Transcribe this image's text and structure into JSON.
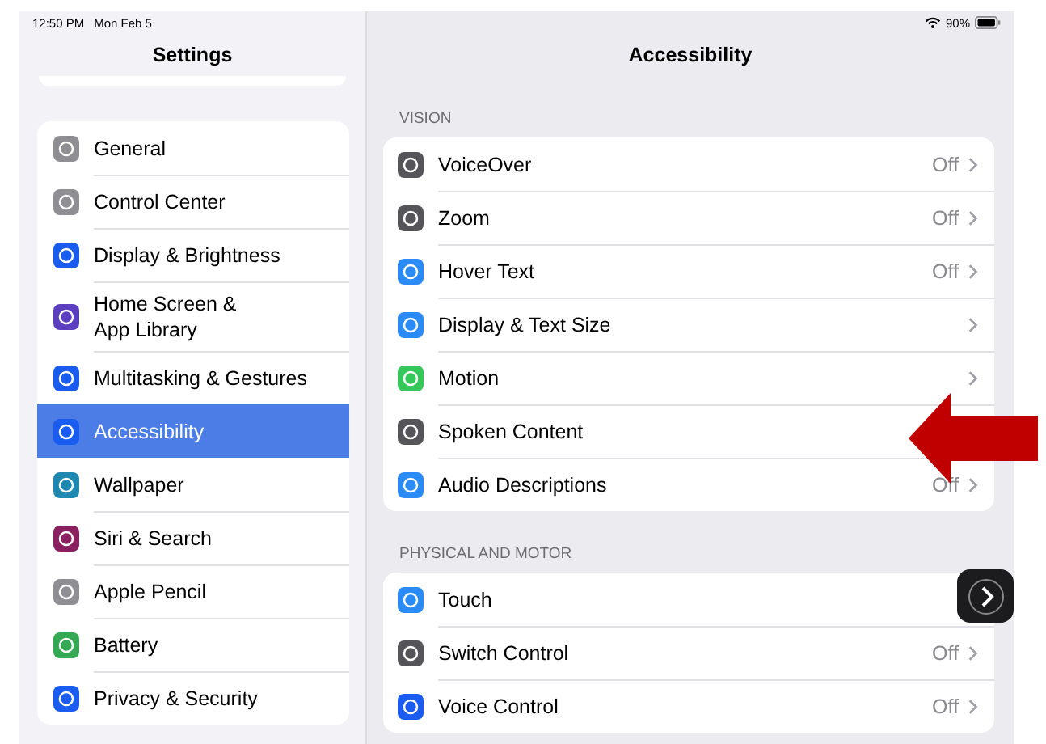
{
  "status_bar": {
    "time": "12:50 PM",
    "date": "Mon Feb 5",
    "battery": "90%"
  },
  "sidebar": {
    "title": "Settings",
    "items": [
      {
        "label": "General",
        "color": "#8e8e93",
        "selected": false
      },
      {
        "label": "Control Center",
        "color": "#8e8e93",
        "selected": false
      },
      {
        "label": "Display & Brightness",
        "color": "#1a5cf0",
        "selected": false
      },
      {
        "label": "Home Screen &\nApp Library",
        "color": "#5b3fc0",
        "selected": false
      },
      {
        "label": "Multitasking & Gestures",
        "color": "#1a5cf0",
        "selected": false
      },
      {
        "label": "Accessibility",
        "color": "#1a5cf0",
        "selected": true
      },
      {
        "label": "Wallpaper",
        "color": "#1e88b0",
        "selected": false
      },
      {
        "label": "Siri & Search",
        "color": "#8a2060",
        "selected": false
      },
      {
        "label": "Apple Pencil",
        "color": "#8e8e93",
        "selected": false
      },
      {
        "label": "Battery",
        "color": "#34a853",
        "selected": false
      },
      {
        "label": "Privacy & Security",
        "color": "#1a5cf0",
        "selected": false
      }
    ]
  },
  "detail": {
    "title": "Accessibility",
    "sections": [
      {
        "header": "VISION",
        "rows": [
          {
            "label": "VoiceOver",
            "value": "Off",
            "chevron": true,
            "color": "#555559"
          },
          {
            "label": "Zoom",
            "value": "Off",
            "chevron": true,
            "color": "#555559"
          },
          {
            "label": "Hover Text",
            "value": "Off",
            "chevron": true,
            "color": "#2a8af6"
          },
          {
            "label": "Display & Text Size",
            "chevron": true,
            "color": "#2a8af6"
          },
          {
            "label": "Motion",
            "chevron": true,
            "color": "#34c759"
          },
          {
            "label": "Spoken Content",
            "chevron": false,
            "color": "#555559"
          },
          {
            "label": "Audio Descriptions",
            "value": "Off",
            "chevron": true,
            "color": "#2a8af6"
          }
        ]
      },
      {
        "header": "PHYSICAL AND MOTOR",
        "rows": [
          {
            "label": "Touch",
            "chevron": false,
            "color": "#2a8af6"
          },
          {
            "label": "Switch Control",
            "value": "Off",
            "chevron": true,
            "color": "#555559"
          },
          {
            "label": "Voice Control",
            "value": "Off",
            "chevron": true,
            "color": "#1a5cf0"
          }
        ]
      }
    ]
  }
}
